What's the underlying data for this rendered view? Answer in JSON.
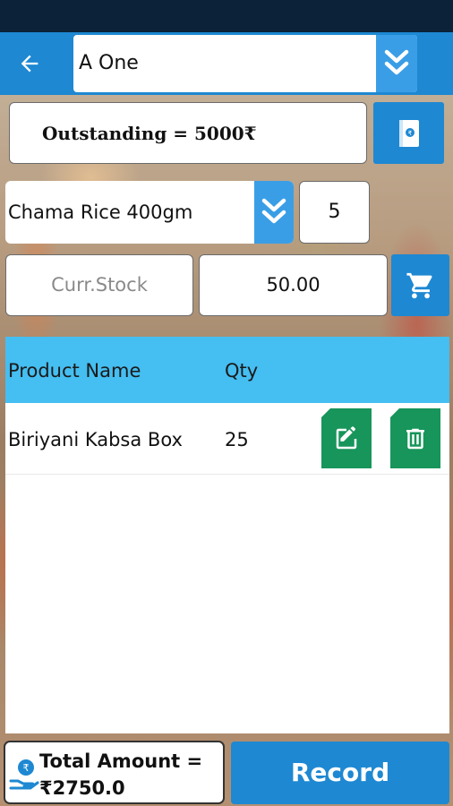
{
  "header": {
    "customer_value": "A One"
  },
  "outstanding": {
    "text": "Outstanding = 5000₹"
  },
  "entry": {
    "product_value": "Chama Rice 400gm",
    "qty_value": "5",
    "stock_placeholder": "Curr.Stock",
    "price_value": "50.00"
  },
  "table": {
    "headers": [
      "Product Name",
      "Qty"
    ],
    "rows": [
      {
        "product": "Biriyani Kabsa Box",
        "qty": "25"
      }
    ]
  },
  "footer": {
    "total_line1": "Total Amount =",
    "total_line2": "₹2750.0",
    "record_label": "Record"
  },
  "icons": {
    "back": "arrow-left-icon",
    "dropdown": "double-chevron-down-icon",
    "ledger": "ledger-book-icon",
    "cart": "cart-icon",
    "edit": "edit-icon",
    "delete": "trash-icon",
    "money": "money-hand-icon"
  },
  "colors": {
    "primary": "#1e88d2",
    "header_row": "#45bef1",
    "action_green": "#17955a",
    "status_bar": "#0b2238"
  }
}
